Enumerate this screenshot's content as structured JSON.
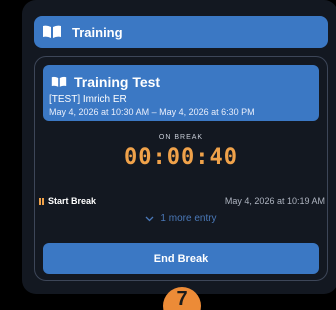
{
  "header": {
    "title": "Training",
    "icon": "book-open-icon"
  },
  "session": {
    "title": "Training Test",
    "subtitle": "[TEST] Imrich ER",
    "date_range": "May 4, 2026 at 10:30 AM – May 4, 2026 at 6:30 PM",
    "status_label": "ON BREAK",
    "timer": "00:00:40"
  },
  "entries": [
    {
      "label": "Start Break",
      "time": "May 4, 2026 at 10:19 AM",
      "icon": "pause-icon"
    }
  ],
  "more_entries_label": "1 more entry",
  "actions": {
    "end_break_label": "End Break"
  },
  "step_badge": "7",
  "colors": {
    "accent_blue": "#3b78c4",
    "panel_bg": "#131821",
    "timer_orange": "#f0a24a",
    "badge_orange": "#ec8b37"
  }
}
